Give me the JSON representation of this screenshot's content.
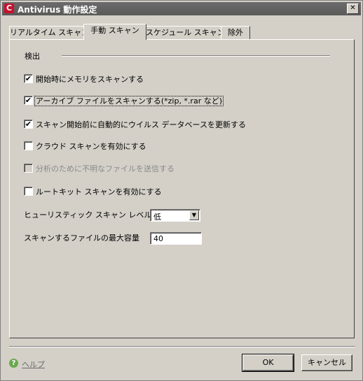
{
  "window": {
    "title": "Antivirus 動作設定",
    "icon_letter": "C",
    "close_glyph": "✕"
  },
  "tabs": [
    {
      "label": "リアルタイム スキャン",
      "active": false
    },
    {
      "label": "手動 スキャン",
      "active": true
    },
    {
      "label": "スケジュール スキャン",
      "active": false
    },
    {
      "label": "除外",
      "active": false
    }
  ],
  "section": {
    "detection_label": "検出"
  },
  "options": [
    {
      "label": "開始時にメモリをスキャンする",
      "checked": true,
      "enabled": true
    },
    {
      "label": "アーカイブ ファイルをスキャンする(*zip, *.rar など)",
      "checked": true,
      "enabled": true,
      "focused": true
    },
    {
      "label": "スキャン開始前に自動的にウイルス データベースを更新する",
      "checked": true,
      "enabled": true
    },
    {
      "label": "クラウド スキャンを有効にする",
      "checked": false,
      "enabled": true
    },
    {
      "label": "分析のために不明なファイルを送信する",
      "checked": false,
      "enabled": false
    },
    {
      "label": "ルートキット スキャンを有効にする",
      "checked": false,
      "enabled": true
    }
  ],
  "heuristic": {
    "label": "ヒューリスティック スキャン レベル",
    "value": "低"
  },
  "max_size": {
    "label": "スキャンするファイルの最大容量",
    "value": "40"
  },
  "footer": {
    "help_label": "ヘルプ",
    "ok_label": "OK",
    "cancel_label": "キャンセル"
  },
  "icons": {
    "check": "✔",
    "dropdown": "▼",
    "help": "?"
  }
}
